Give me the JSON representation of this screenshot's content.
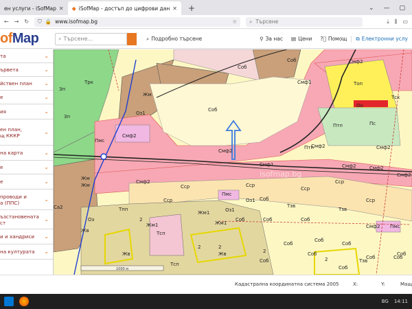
{
  "browser": {
    "tabs": [
      {
        "label": "ен услуги - iSofMap"
      },
      {
        "label": "iSofMap - достъп до цифрови дан"
      }
    ],
    "url_domain": "www.isofmap.bg",
    "search_placeholder": "Търсене"
  },
  "app": {
    "logo_prefix": "of",
    "logo_suffix": "Map",
    "search_placeholder": "Търсене...",
    "detailed_search": "Подробно търсене",
    "menu": {
      "about": "За нас",
      "prices": "Цени",
      "help": "Помощ",
      "services": "Електронни услу"
    }
  },
  "sidebar": {
    "items": [
      {
        "label": "та"
      },
      {
        "label": "ървета"
      },
      {
        "label": "йствен план"
      },
      {
        "label": "е"
      },
      {
        "label": "ия"
      },
      {
        "label": "ен план,\nщ КККР"
      },
      {
        "label": "на карта"
      },
      {
        "label": "е"
      },
      {
        "label": "е"
      },
      {
        "label": "проводи и\nа (ППС)"
      },
      {
        "label": "ъзстановената\nст"
      },
      {
        "label": "и и хандриси"
      },
      {
        "label": "на културата"
      }
    ]
  },
  "map": {
    "labels": [
      "Зп",
      "Трк",
      "Зп",
      "Жм",
      "Оз1",
      "Соб",
      "Соб",
      "Соб",
      "Смф1",
      "Топ",
      "Оо",
      "Тск",
      "Смф2",
      "Пмс",
      "Смф2",
      "Смф2",
      "Птп",
      "Птп",
      "Пс",
      "Смф2",
      "Смф2",
      "Смф1",
      "Смф2",
      "Жм",
      "Смф2",
      "Смф2",
      "Смф2",
      "Жм",
      "Сср",
      "Сср",
      "Сср",
      "Сср",
      "Сср",
      "Пмс",
      "Тзв",
      "Оз1",
      "Сср",
      "Са2",
      "Тпп",
      "Жм1",
      "Оз1",
      "Жм1",
      "Тсп",
      "Соб",
      "Соб",
      "Соб",
      "Смф2",
      "Пмс",
      "Тзв",
      "Соб",
      "Соб",
      "Соб",
      "Соб",
      "Соб",
      "Соб",
      "Жм1",
      "Оз",
      "2",
      "2",
      "2",
      "2",
      "2",
      "Жв",
      "Жв",
      "Жв",
      "Тсп",
      "Соб",
      "Соб",
      "Соб",
      "Тзв",
      "Соб"
    ],
    "watermark": "isofmap.bg",
    "scale_label": "1000 м"
  },
  "status": {
    "coord_system": "Кадастрална координатна система 2005",
    "x_label": "X:",
    "y_label": "Y:",
    "scale": "Мащ"
  },
  "taskbar": {
    "lang": "BG",
    "time": "14:11"
  }
}
